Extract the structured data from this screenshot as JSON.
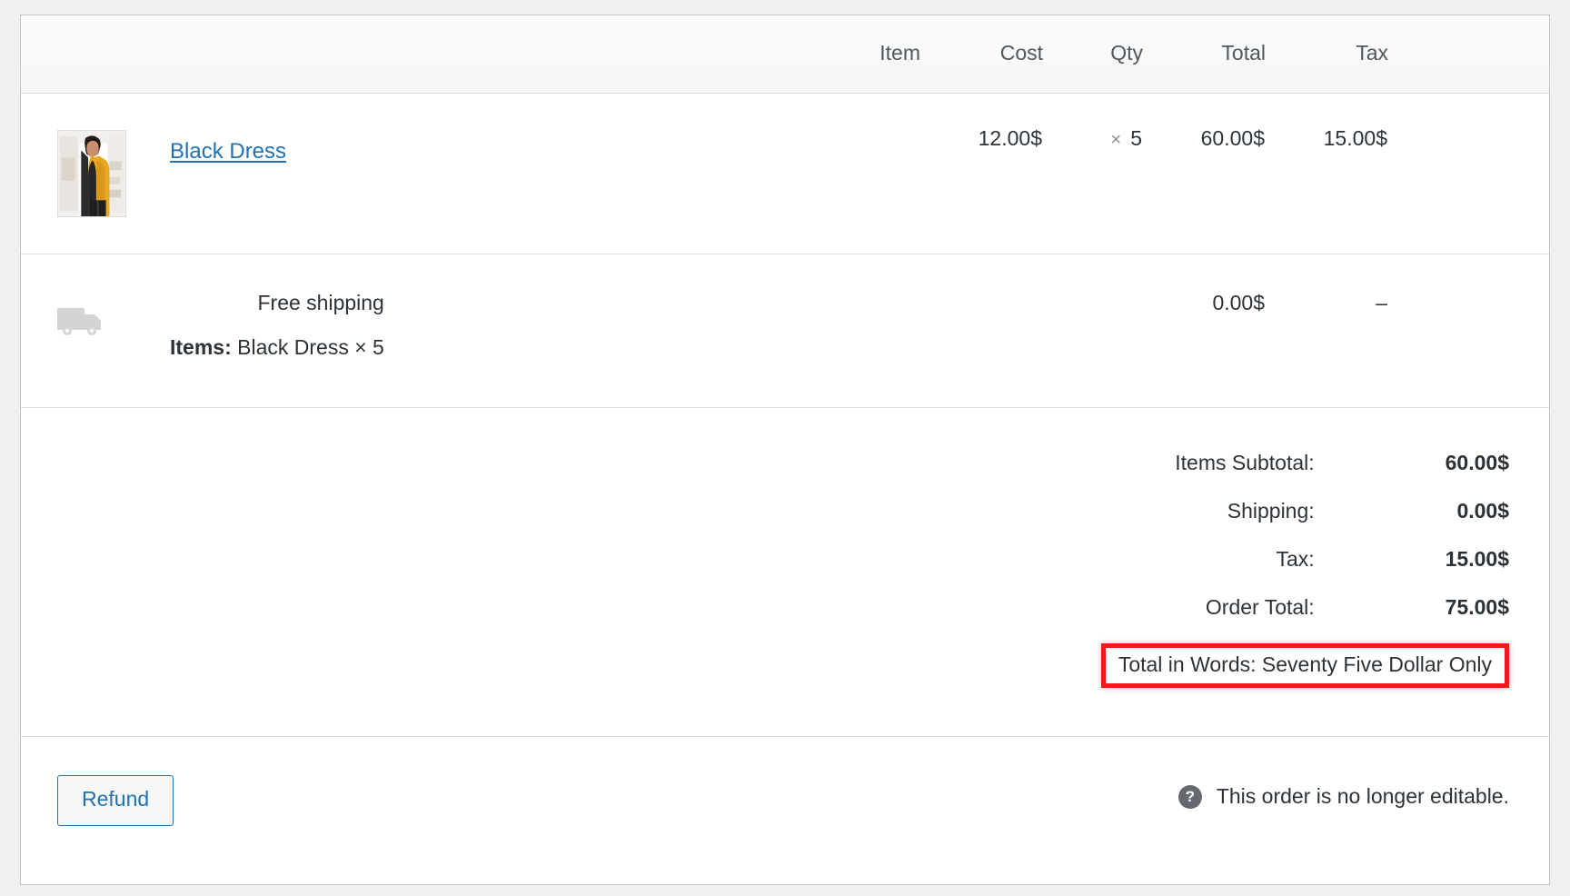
{
  "table": {
    "columns": {
      "item": "Item",
      "cost": "Cost",
      "qty": "Qty",
      "total": "Total",
      "tax": "Tax"
    },
    "line_items": [
      {
        "name": "Black Dress",
        "cost": "12.00$",
        "qty_multiplier": "×",
        "qty": "5",
        "total": "60.00$",
        "tax": "15.00$",
        "thumbnail_alt": "product-thumbnail"
      }
    ],
    "shipping_rows": [
      {
        "icon": "truck-icon",
        "title": "Free shipping",
        "meta_label": "Items:",
        "meta_value": "Black Dress × 5",
        "total": "0.00$",
        "tax": "–"
      }
    ]
  },
  "totals": {
    "rows": [
      {
        "label": "Items Subtotal:",
        "value": "60.00$"
      },
      {
        "label": "Shipping:",
        "value": "0.00$"
      },
      {
        "label": "Tax:",
        "value": "15.00$"
      },
      {
        "label": "Order Total:",
        "value": "75.00$"
      }
    ],
    "total_in_words": "Total in Words: Seventy Five Dollar Only",
    "highlight_color": "#ef1b1b"
  },
  "footer": {
    "refund_label": "Refund",
    "help_icon": "question-mark-icon",
    "notice": "This order is no longer editable."
  },
  "theme": {
    "link_color": "#2271b1",
    "text_color": "#2c3338",
    "muted_color": "#50575e",
    "border_color": "#dcdcde",
    "panel_border": "#c3c4c7",
    "page_bg": "#f0f0f1"
  }
}
